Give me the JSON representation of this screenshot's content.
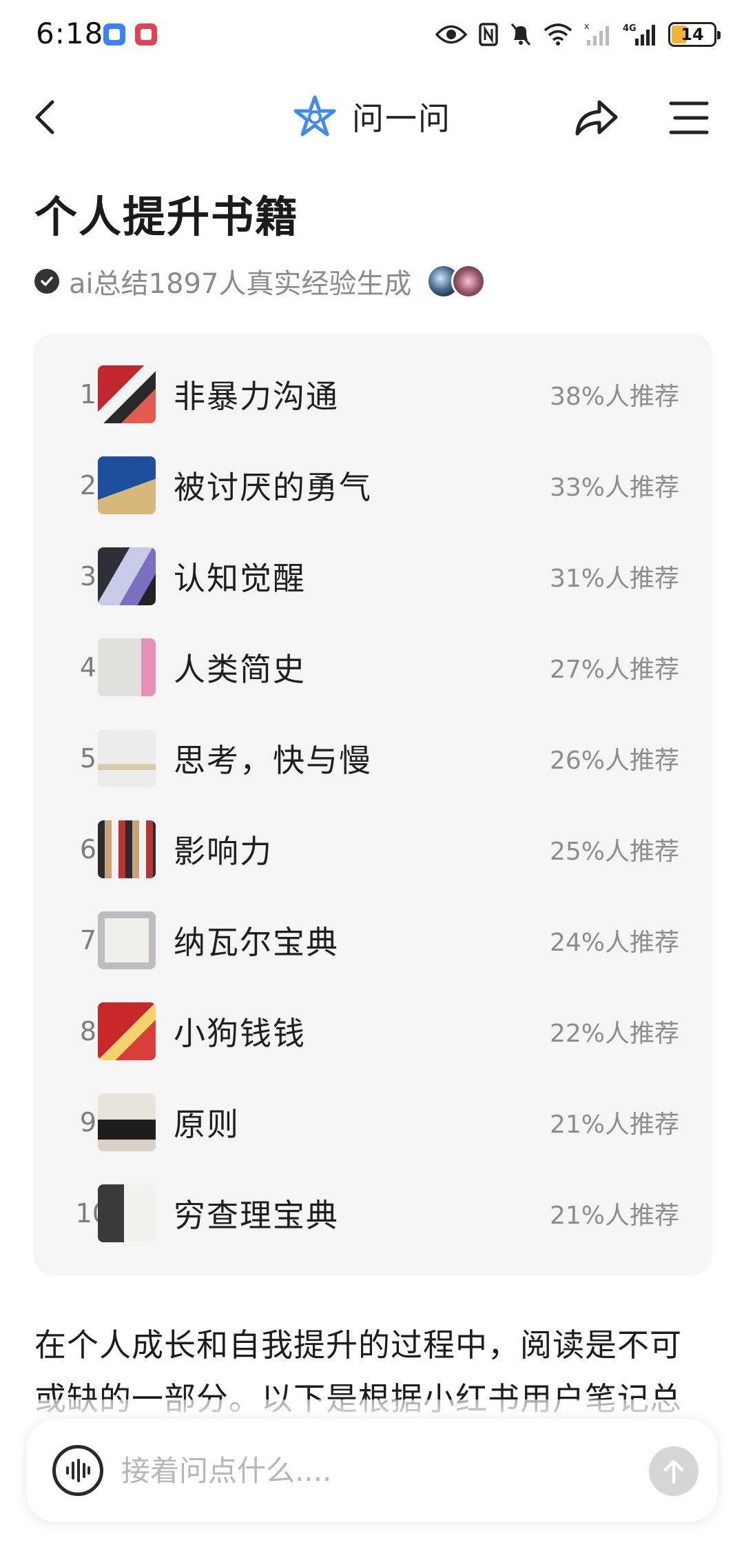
{
  "status_bar": {
    "time": "6:18",
    "battery": "14",
    "network": "4G"
  },
  "header": {
    "title": "问一问",
    "accent_color": "#3d8bf0"
  },
  "page": {
    "title": "个人提升书籍",
    "source_text": "ai总结1897人真实经验生成"
  },
  "ranking": [
    {
      "rank": "1",
      "name": "非暴力沟通",
      "percent": "38%人推荐"
    },
    {
      "rank": "2",
      "name": "被讨厌的勇气",
      "percent": "33%人推荐"
    },
    {
      "rank": "3",
      "name": "认知觉醒",
      "percent": "31%人推荐"
    },
    {
      "rank": "4",
      "name": "人类简史",
      "percent": "27%人推荐"
    },
    {
      "rank": "5",
      "name": "思考，快与慢",
      "percent": "26%人推荐"
    },
    {
      "rank": "6",
      "name": "影响力",
      "percent": "25%人推荐"
    },
    {
      "rank": "7",
      "name": "纳瓦尔宝典",
      "percent": "24%人推荐"
    },
    {
      "rank": "8",
      "name": "小狗钱钱",
      "percent": "22%人推荐"
    },
    {
      "rank": "9",
      "name": "原则",
      "percent": "21%人推荐"
    },
    {
      "rank": "10",
      "name": "穷查理宝典",
      "percent": "21%人推荐"
    }
  ],
  "body": {
    "paragraph_line1": "在个人成长和自我提升的过程中，阅读是不可",
    "paragraph_line2": "或缺的一部分。以下是根据小红书用户笔记总"
  },
  "input": {
    "placeholder": "接着问点什么...."
  }
}
